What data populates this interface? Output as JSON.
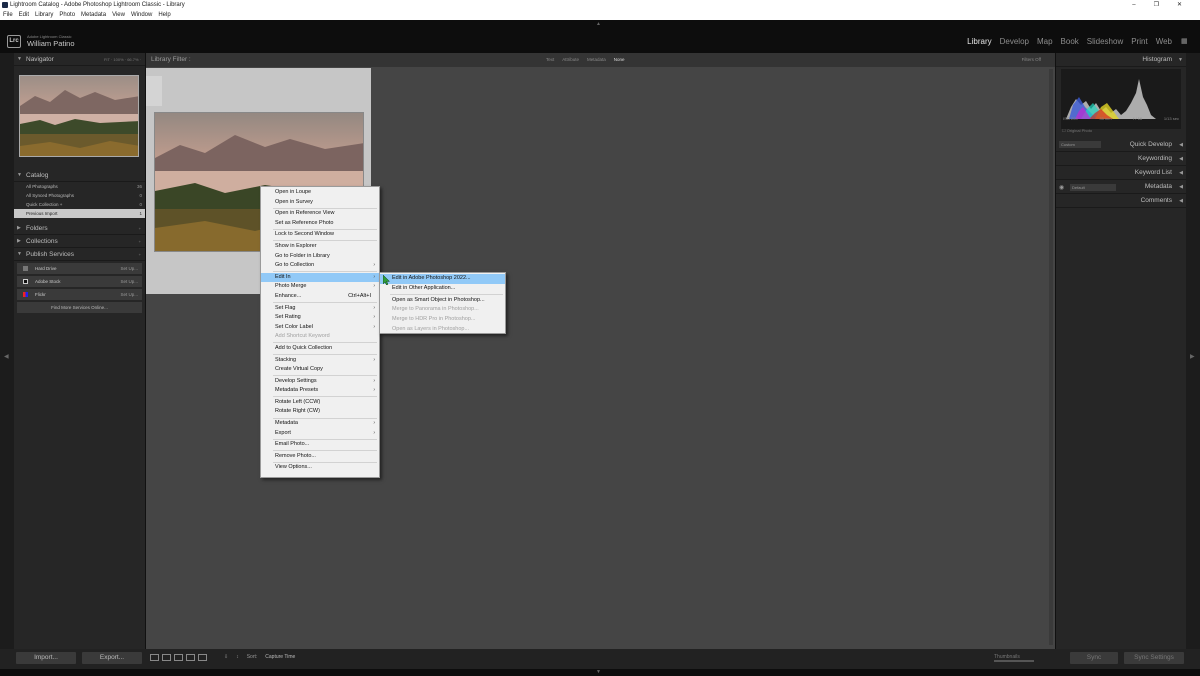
{
  "window": {
    "title": "Lightroom Catalog - Adobe Photoshop Lightroom Classic - Library",
    "controls": [
      "–",
      "❐",
      "✕"
    ]
  },
  "menubar": [
    "File",
    "Edit",
    "Library",
    "Photo",
    "Metadata",
    "View",
    "Window",
    "Help"
  ],
  "identity": {
    "badge": "Lrc",
    "small": "Adobe Lightroom Classic",
    "name": "William Patino"
  },
  "modules": [
    "Library",
    "Develop",
    "Map",
    "Book",
    "Slideshow",
    "Print",
    "Web"
  ],
  "active_module": "Library",
  "left_panel": {
    "navigator": {
      "title": "Navigator",
      "zoom": "FIT  ·  100%  ·  66.7%  ·"
    },
    "catalog": {
      "title": "Catalog",
      "items": [
        {
          "label": "All Photographs",
          "count": "36"
        },
        {
          "label": "All Synced Photographs",
          "count": "0"
        },
        {
          "label": "Quick Collection +",
          "count": "0"
        },
        {
          "label": "Previous Import",
          "count": "1"
        }
      ]
    },
    "folders": "Folders",
    "collections": "Collections",
    "publish": {
      "title": "Publish Services",
      "items": [
        {
          "label": "Hard Drive",
          "setup": "Set Up..."
        },
        {
          "label": "Adobe Stock",
          "setup": "Set Up..."
        },
        {
          "label": "Flickr",
          "setup": "Set Up..."
        }
      ],
      "find_more": "Find More Services Online..."
    }
  },
  "filter_bar": {
    "label": "Library Filter :",
    "tabs": [
      "Text",
      "Attribute",
      "Metadata",
      "None"
    ],
    "active_tab": "None",
    "filters_off": "Filters Off"
  },
  "context_menu": {
    "items": [
      {
        "label": "Open in Loupe"
      },
      {
        "label": "Open in Survey"
      },
      {
        "sep": true
      },
      {
        "label": "Open in Reference View"
      },
      {
        "label": "Set as Reference Photo"
      },
      {
        "sep": true
      },
      {
        "label": "Lock to Second Window"
      },
      {
        "sep": true
      },
      {
        "label": "Show in Explorer"
      },
      {
        "label": "Go to Folder in Library"
      },
      {
        "label": "Go to Collection",
        "submenu": true
      },
      {
        "sep": true
      },
      {
        "label": "Edit In",
        "submenu": true,
        "highlighted": true
      },
      {
        "label": "Photo Merge",
        "submenu": true
      },
      {
        "label": "Enhance...",
        "shortcut": "Ctrl+Alt+I"
      },
      {
        "sep": true
      },
      {
        "label": "Set Flag",
        "submenu": true
      },
      {
        "label": "Set Rating",
        "submenu": true
      },
      {
        "label": "Set Color Label",
        "submenu": true
      },
      {
        "label": "Add Shortcut Keyword",
        "disabled": true
      },
      {
        "sep": true
      },
      {
        "label": "Add to Quick Collection"
      },
      {
        "sep": true
      },
      {
        "label": "Stacking",
        "submenu": true
      },
      {
        "label": "Create Virtual Copy"
      },
      {
        "sep": true
      },
      {
        "label": "Develop Settings",
        "submenu": true
      },
      {
        "label": "Metadata Presets",
        "submenu": true
      },
      {
        "sep": true
      },
      {
        "label": "Rotate Left (CCW)"
      },
      {
        "label": "Rotate Right (CW)"
      },
      {
        "sep": true
      },
      {
        "label": "Metadata",
        "submenu": true
      },
      {
        "label": "Export",
        "submenu": true
      },
      {
        "sep": true
      },
      {
        "label": "Email Photo..."
      },
      {
        "sep": true
      },
      {
        "label": "Remove Photo..."
      },
      {
        "sep": true
      },
      {
        "label": "View Options..."
      }
    ]
  },
  "submenu": {
    "items": [
      {
        "label": "Edit in Adobe Photoshop 2022...",
        "highlighted": true
      },
      {
        "label": "Edit in Other Application..."
      },
      {
        "sep": true
      },
      {
        "label": "Open as Smart Object in Photoshop..."
      },
      {
        "label": "Merge to Panorama in Photoshop...",
        "disabled": true
      },
      {
        "label": "Merge to HDR Pro in Photoshop...",
        "disabled": true
      },
      {
        "label": "Open as Layers in Photoshop...",
        "disabled": true
      }
    ]
  },
  "right_panel": {
    "histogram": "Histogram",
    "histo_info": [
      "ISO 200",
      "35 mm",
      "f / 16",
      "1/13 sec"
    ],
    "original_photo": "Original Photo",
    "quick_develop": "Quick Develop",
    "qd_preset": "Custom",
    "keywording": "Keywording",
    "keyword_list": "Keyword List",
    "metadata": "Metadata",
    "metadata_preset": "Default",
    "comments": "Comments"
  },
  "bottom": {
    "import": "Import...",
    "export": "Export...",
    "sort_label": "Sort:",
    "sort_value": "Capture Time",
    "thumbnails": "Thumbnails",
    "sync": "Sync",
    "sync_settings": "Sync Settings"
  },
  "colors": {
    "accent_highlight": "#91c9f7",
    "panel": "#262626",
    "center": "#454545"
  }
}
